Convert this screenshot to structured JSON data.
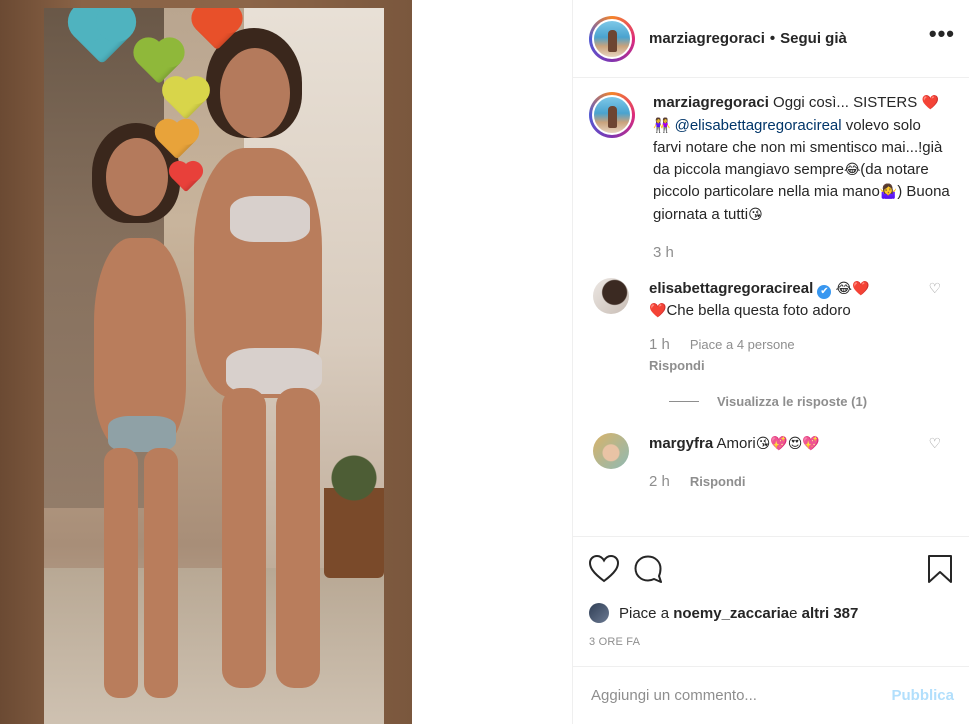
{
  "post_author": "marziagregoraci",
  "header": {
    "separator": "•",
    "follow_status": "Segui già",
    "more": "•••"
  },
  "caption": {
    "username": "marziagregoraci",
    "text_1": " Oggi così... SISTERS ",
    "emoji_1": "❤️",
    "emoji_2": "👭",
    "mention": " @elisabettagregoracireal",
    "text_2": " volevo solo farvi notare che non mi smentisco mai...!già da piccola mangiavo sempre",
    "emoji_3": "😂",
    "text_3": "(da notare piccolo particolare nella mia mano",
    "emoji_4": "🤷‍♀️",
    "text_4": ") Buona giornata a tutti",
    "emoji_5": "😘",
    "time": "3 h"
  },
  "comments": [
    {
      "username": "elisabettagregoracireal",
      "verified": "✔",
      "emoji_head": "😂❤️",
      "emoji_lead": "❤️",
      "text": "Che bella questa foto adoro",
      "time": "1 h",
      "likes": "Piace a 4 persone",
      "reply": "Rispondi",
      "view_replies": "Visualizza le risposte (1)"
    },
    {
      "username": "margyfra",
      "text": " Amori",
      "emoji": "😘💖😍💖",
      "time": "2 h",
      "reply": "Rispondi"
    }
  ],
  "likes": {
    "prefix": "Piace a ",
    "user": "noemy_zaccaria",
    "middle": " e ",
    "others": "altri 387"
  },
  "timestamp": "3 ORE FA",
  "add_comment": {
    "placeholder": "Aggiungi un commento...",
    "publish": "Pubblica"
  },
  "colors": {
    "link": "#003569",
    "muted": "#8e8e8e",
    "publish_disabled": "#b2dffc",
    "hearts": [
      "#4fb3bf",
      "#e8502a",
      "#8fb83a",
      "#d8d54a",
      "#e8a33a",
      "#e8403a"
    ]
  }
}
